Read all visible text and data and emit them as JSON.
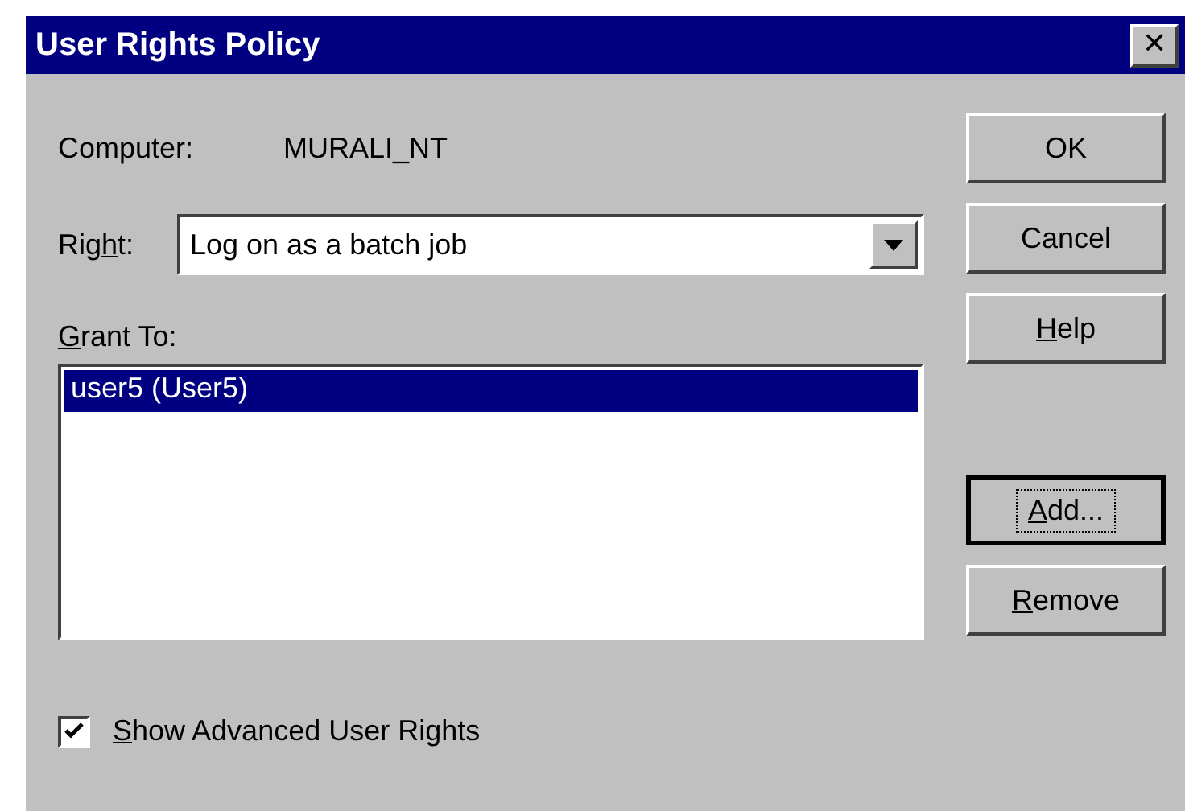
{
  "window": {
    "title": "User Rights Policy",
    "close_glyph": "✕"
  },
  "computer": {
    "label": "Computer:",
    "value": "MURALI_NT"
  },
  "right": {
    "label": {
      "before": "Rig",
      "key": "h",
      "after": "t:"
    },
    "value": "Log on as a batch job"
  },
  "grant_to": {
    "label": {
      "key": "G",
      "after": "rant To:"
    },
    "items": [
      {
        "text": "user5 (User5)",
        "selected": true
      }
    ]
  },
  "show_advanced": {
    "label": {
      "key": "S",
      "after": "how Advanced User Rights"
    },
    "checked": true
  },
  "top_buttons": [
    {
      "label": {
        "before": "OK"
      },
      "focused": false
    },
    {
      "label": {
        "before": "Cancel"
      },
      "focused": false
    },
    {
      "label": {
        "key": "H",
        "after": "elp"
      },
      "focused": false
    }
  ],
  "lower_buttons": [
    {
      "label": {
        "key": "A",
        "after": "dd..."
      },
      "focused": true
    },
    {
      "label": {
        "key": "R",
        "after": "emove"
      },
      "focused": false
    }
  ]
}
